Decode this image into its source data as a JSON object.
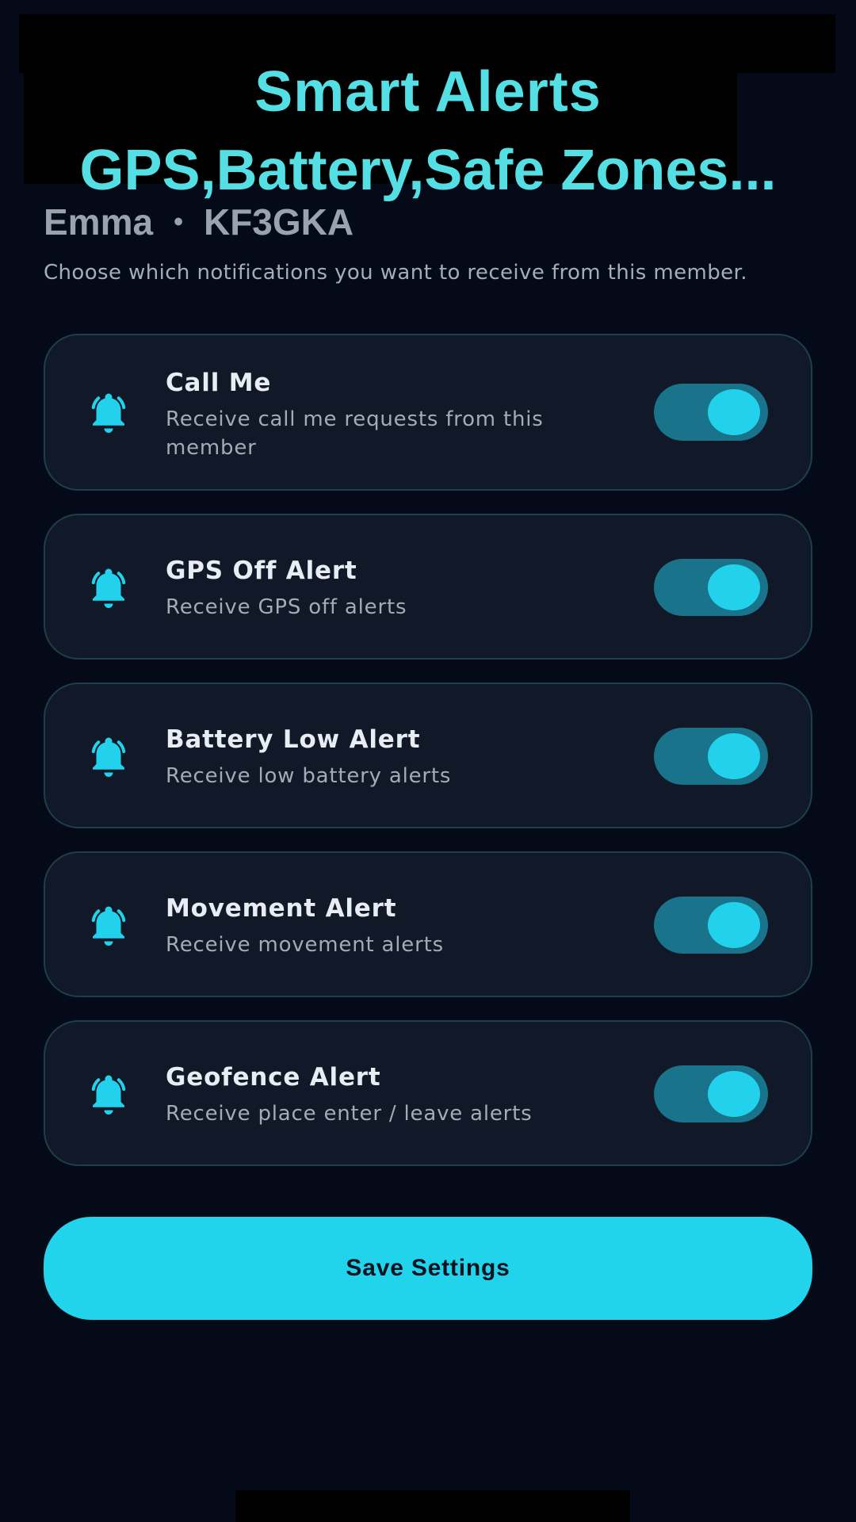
{
  "banner": {
    "title": "Smart Alerts",
    "subtitle": "GPS,Battery,Safe Zones..."
  },
  "member": {
    "name": "Emma",
    "separator": "•",
    "code": "KF3GKA",
    "description": "Choose which notifications you want to receive from this member."
  },
  "settings": [
    {
      "title": "Call Me",
      "subtitle": "Receive call me requests from this member",
      "icon": "bell-ring-icon",
      "enabled": true
    },
    {
      "title": "GPS Off Alert",
      "subtitle": "Receive GPS off alerts",
      "icon": "bell-ring-icon",
      "enabled": true
    },
    {
      "title": "Battery Low Alert",
      "subtitle": "Receive low battery alerts",
      "icon": "bell-ring-icon",
      "enabled": true
    },
    {
      "title": "Movement Alert",
      "subtitle": "Receive movement alerts",
      "icon": "bell-ring-icon",
      "enabled": true
    },
    {
      "title": "Geofence Alert",
      "subtitle": "Receive place enter / leave alerts",
      "icon": "bell-ring-icon",
      "enabled": true
    }
  ],
  "save_button": {
    "label": "Save Settings"
  },
  "colors": {
    "accent": "#22d3ec",
    "banner_text": "#54dfe4",
    "background": "#050a18",
    "card": "#111827",
    "toggle_track": "#19738a"
  }
}
